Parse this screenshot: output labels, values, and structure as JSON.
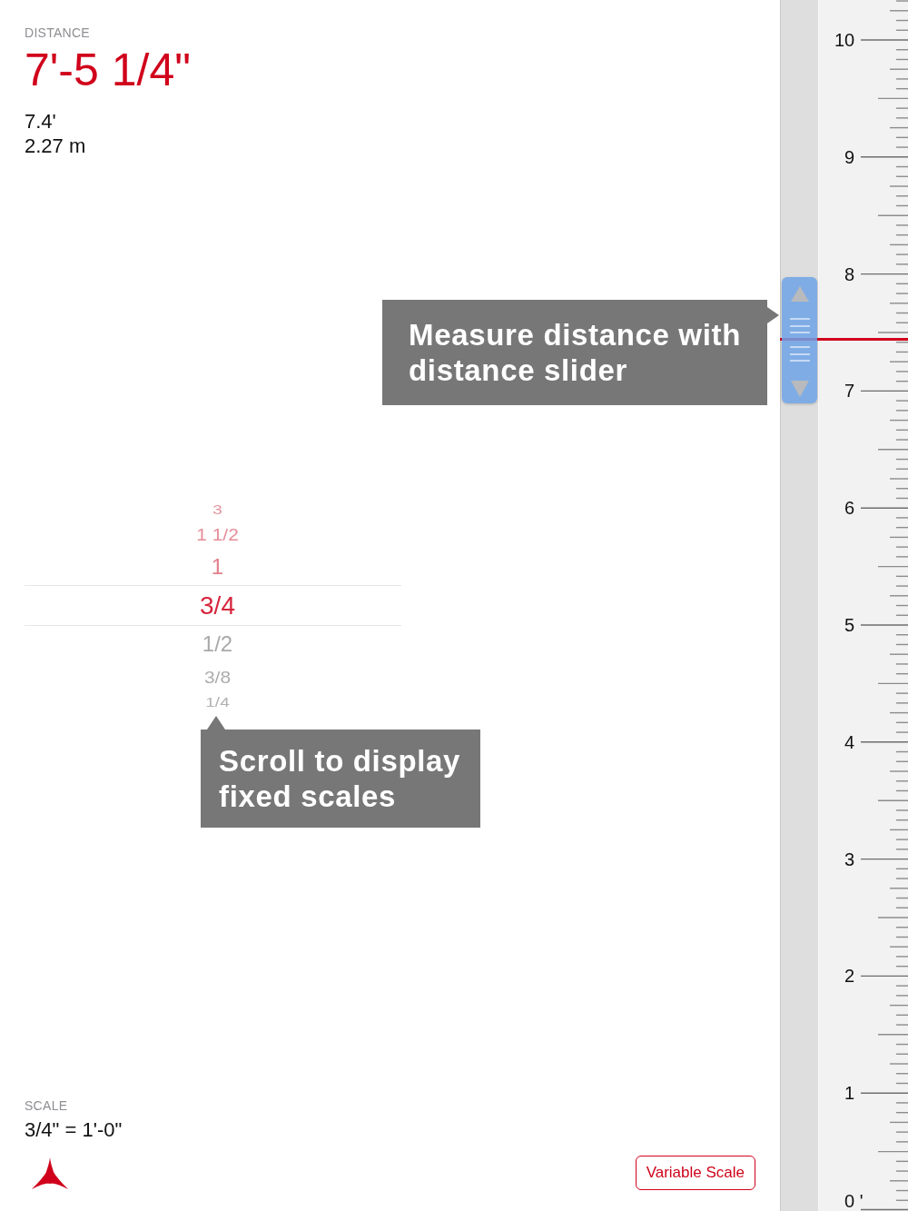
{
  "distance": {
    "label": "DISTANCE",
    "value": "7'-5 1/4\"",
    "feet": "7.4'",
    "meters": "2.27 m"
  },
  "slider_tip": {
    "text": "Measure distance with\ndistance slider"
  },
  "distance_slider": {
    "level": 0.72
  },
  "scale_picker": {
    "items": [
      {
        "label": "3",
        "selected": false,
        "color": "#e4949e"
      },
      {
        "label": "1 1/2",
        "selected": false,
        "color": "#e58e99"
      },
      {
        "label": "1",
        "selected": false,
        "color": "#e27f8b"
      },
      {
        "label": "3/4",
        "selected": true,
        "color": "#d6263d"
      },
      {
        "label": "1/2",
        "selected": false,
        "color": "#a9a9a9"
      },
      {
        "label": "3/8",
        "selected": false,
        "color": "#aeaeae"
      },
      {
        "label": "1/4",
        "selected": false,
        "color": "#b2b2b2"
      }
    ]
  },
  "picker_tip": {
    "text": "Scroll to display\nfixed scales"
  },
  "scale": {
    "label": "SCALE",
    "value": "3/4\" = 1'-0\""
  },
  "variable_scale_button": {
    "label": "Variable Scale"
  },
  "ruler": {
    "labels": [
      "10",
      "9",
      "8",
      "7",
      "6",
      "5",
      "4",
      "3",
      "2",
      "1",
      "0 '"
    ]
  }
}
